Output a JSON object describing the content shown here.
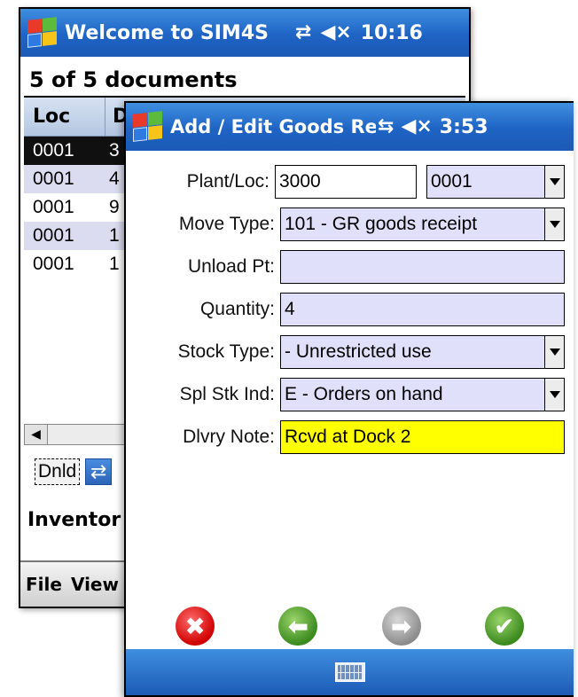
{
  "back_window": {
    "title": "Welcome to SIM4S",
    "clock": "10:16",
    "icons": [
      "windows-logo-icon",
      "connectivity-icon",
      "volume-muted-icon"
    ],
    "doc_count": "5 of 5 documents",
    "columns": [
      "Loc",
      "D"
    ],
    "rows": [
      {
        "loc": "0001",
        "d": "3"
      },
      {
        "loc": "0001",
        "d": "4"
      },
      {
        "loc": "0001",
        "d": "9"
      },
      {
        "loc": "0001",
        "d": "1"
      },
      {
        "loc": "0001",
        "d": "1"
      }
    ],
    "dnld_label": "Dnld",
    "inventory_label": "Inventor",
    "menu": {
      "file": "File",
      "view": "View"
    }
  },
  "front_window": {
    "title": "Add / Edit Goods Re",
    "clock": "3:53",
    "icons": [
      "windows-logo-icon",
      "connectivity-icon",
      "volume-muted-icon"
    ],
    "form": {
      "plant_loc": {
        "label": "Plant/Loc:",
        "plant": "3000",
        "loc": "0001"
      },
      "move_type": {
        "label": "Move Type:",
        "value": "101 - GR goods receipt"
      },
      "unload_pt": {
        "label": "Unload Pt:",
        "value": ""
      },
      "quantity": {
        "label": "Quantity:",
        "value": "4"
      },
      "stock_type": {
        "label": "Stock Type:",
        "value": "- Unrestricted use"
      },
      "spl_stk_ind": {
        "label": "Spl Stk Ind:",
        "value": "E - Orders on hand"
      },
      "dlvry_note": {
        "label": "Dlvry Note:",
        "value": "Rcvd at Dock 2"
      }
    },
    "actions": {
      "cancel": "✖",
      "back": "⬅",
      "forward": "➡",
      "ok": "✔"
    }
  },
  "colors": {
    "titlebar": "#1e63c4",
    "field_bg": "#e0e0fa",
    "highlight_field": "#ffff00",
    "cancel": "#d00000",
    "ok": "#3b8a1e"
  }
}
